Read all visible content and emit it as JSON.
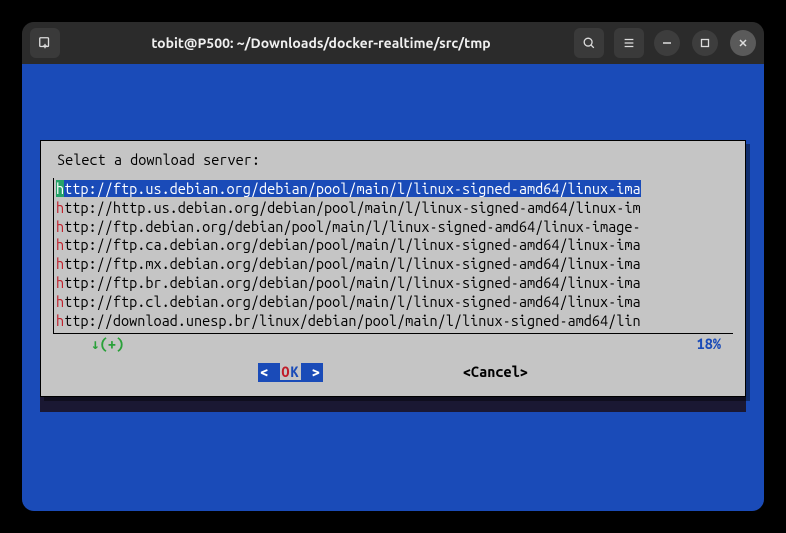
{
  "titlebar": {
    "title": "tobit@P500: ~/Downloads/docker-realtime/src/tmp"
  },
  "dialog": {
    "prompt": "Select a download server:",
    "lines": [
      {
        "prefix": "h",
        "rest": "ttp://ftp.us.debian.org/debian/pool/main/l/linux-signed-amd64/linux-ima",
        "selected": true
      },
      {
        "prefix": "h",
        "rest": "ttp://http.us.debian.org/debian/pool/main/l/linux-signed-amd64/linux-im",
        "selected": false
      },
      {
        "prefix": "h",
        "rest": "ttp://ftp.debian.org/debian/pool/main/l/linux-signed-amd64/linux-image-",
        "selected": false
      },
      {
        "prefix": "h",
        "rest": "ttp://ftp.ca.debian.org/debian/pool/main/l/linux-signed-amd64/linux-ima",
        "selected": false
      },
      {
        "prefix": "h",
        "rest": "ttp://ftp.mx.debian.org/debian/pool/main/l/linux-signed-amd64/linux-ima",
        "selected": false
      },
      {
        "prefix": "h",
        "rest": "ttp://ftp.br.debian.org/debian/pool/main/l/linux-signed-amd64/linux-ima",
        "selected": false
      },
      {
        "prefix": "h",
        "rest": "ttp://ftp.cl.debian.org/debian/pool/main/l/linux-signed-amd64/linux-ima",
        "selected": false
      },
      {
        "prefix": "h",
        "rest": "ttp://download.unesp.br/linux/debian/pool/main/l/linux-signed-amd64/lin",
        "selected": false
      }
    ],
    "scroll_indicator": "↓(+)",
    "percent": "18%",
    "ok_label": "OK",
    "cancel_label": "<Cancel>"
  }
}
